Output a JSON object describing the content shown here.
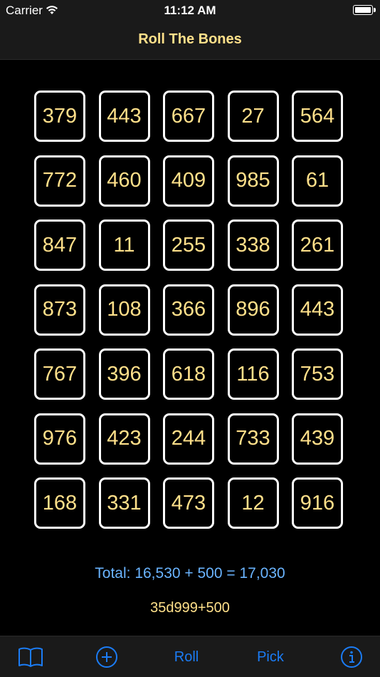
{
  "status_bar": {
    "carrier": "Carrier",
    "time": "11:12 AM"
  },
  "nav": {
    "title": "Roll The Bones"
  },
  "dice": [
    379,
    443,
    667,
    27,
    564,
    772,
    460,
    409,
    985,
    61,
    847,
    11,
    255,
    338,
    261,
    873,
    108,
    366,
    896,
    443,
    767,
    396,
    618,
    116,
    753,
    976,
    423,
    244,
    733,
    439,
    168,
    331,
    473,
    12,
    916
  ],
  "summary": {
    "total": "Total: 16,530 + 500 = 17,030",
    "formula": "35d999+500"
  },
  "tab_bar": {
    "book_icon": "book-icon",
    "add_icon": "plus-circle-icon",
    "roll_label": "Roll",
    "pick_label": "Pick",
    "info_icon": "info-icon"
  },
  "colors": {
    "accent": "#1b7cf5",
    "die_text": "#ffe08a",
    "total_text": "#6ab4ff"
  }
}
